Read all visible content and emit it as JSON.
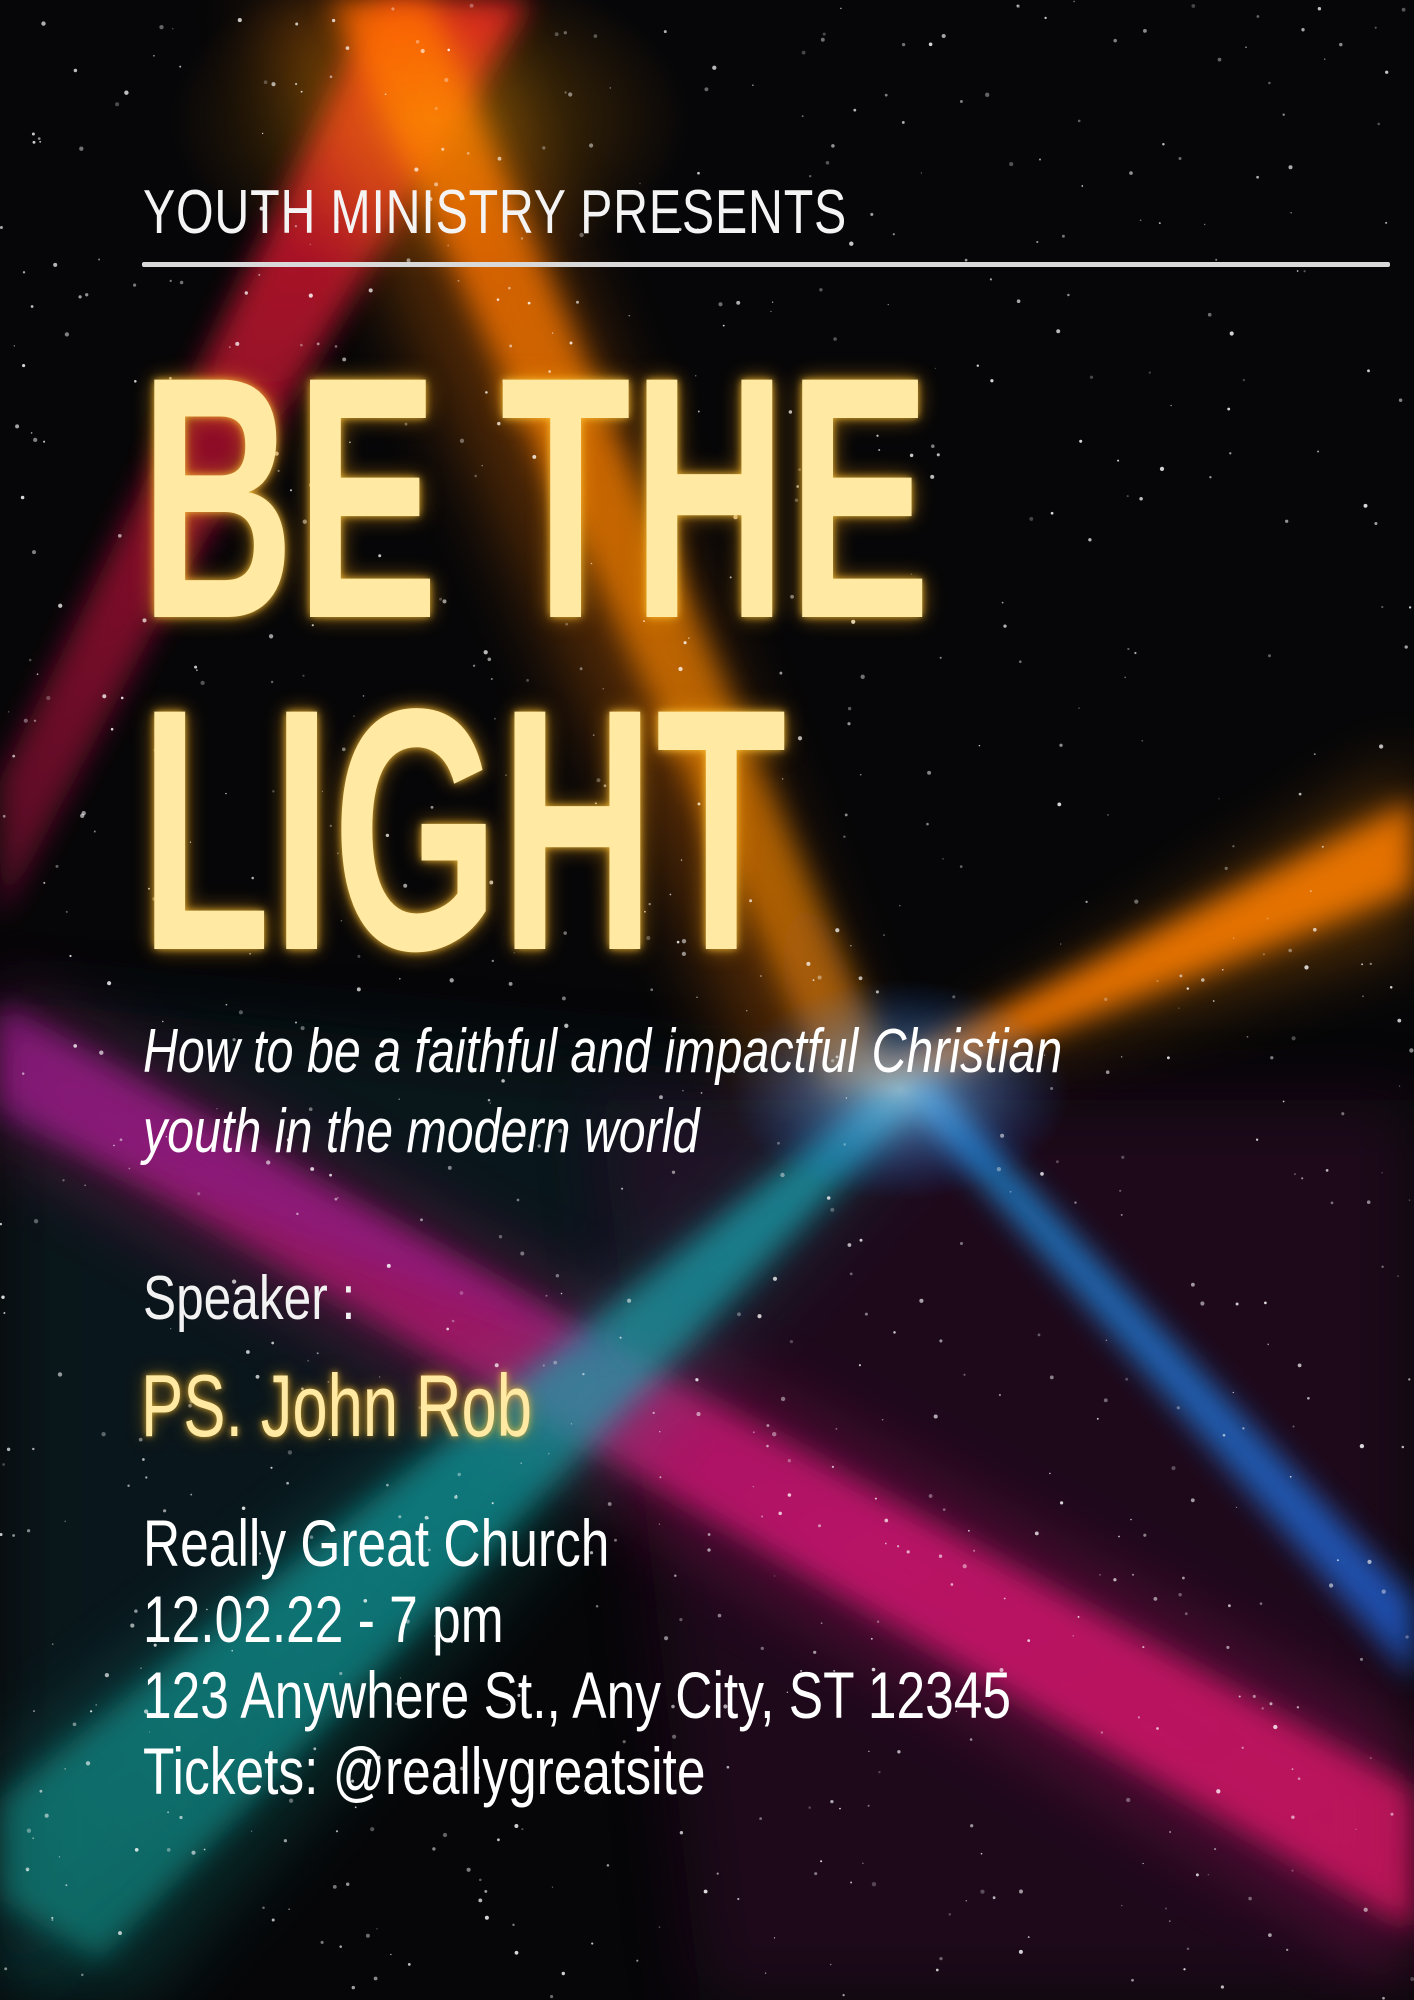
{
  "poster": {
    "eyebrow": "YOUTH MINISTRY PRESENTS",
    "title_line_1": "BE THE",
    "title_line_2": "LIGHT",
    "subtitle_line_1": "How to be a faithful and impactful Christian",
    "subtitle_line_2": "youth in the modern world",
    "speaker_label": "Speaker :",
    "speaker_name": "PS. John Rob",
    "venue": "Really Great Church",
    "date_time": "12.02.22 - 7 pm",
    "address": "123 Anywhere St., Any City, ST 12345",
    "tickets": "Tickets: @reallygreatsite"
  },
  "colors": {
    "background": "#060608",
    "title": "#ffe9a3",
    "title_glow": "#ffaa14",
    "text": "#ffffff",
    "rule": "#d9d9d9",
    "beam_orange": "#ff7a00",
    "beam_red": "#ff1a3c",
    "beam_magenta": "#e0157a",
    "beam_blue": "#1f8fff",
    "beam_teal": "#16a8a0"
  }
}
